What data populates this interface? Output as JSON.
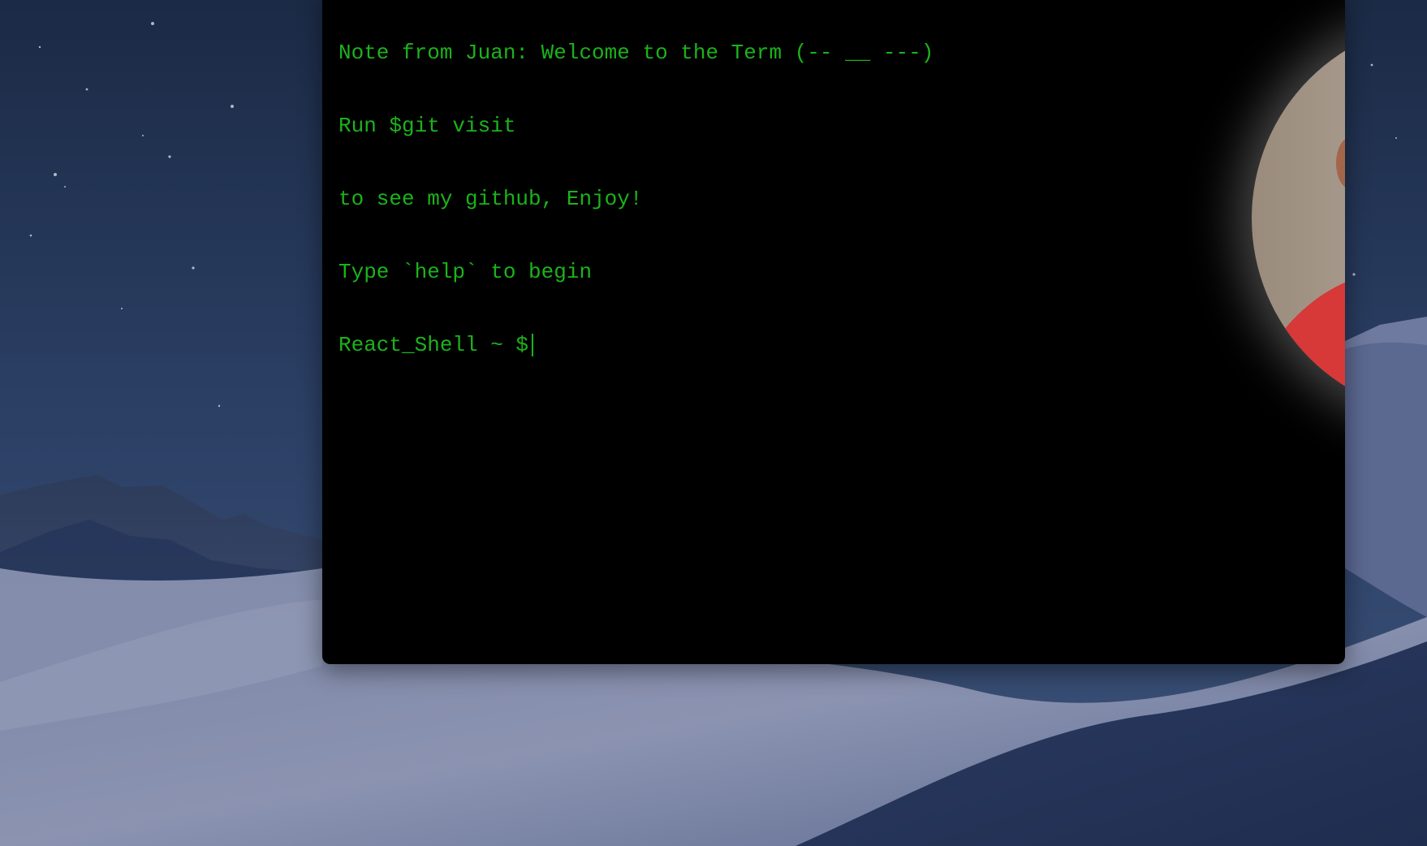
{
  "terminal": {
    "lines": [
      "Note from Juan: Welcome to the Term (-- __ ---)",
      "Run $git visit",
      "to see my github, Enjoy!",
      "Type `help` to begin"
    ],
    "prompt": "React_Shell ~ $",
    "input_value": "",
    "text_color": "#1bb31b",
    "background": "#000000"
  },
  "avatar": {
    "icon": "profile-photo"
  },
  "desktop": {
    "wallpaper": "mojave-night-dunes"
  }
}
